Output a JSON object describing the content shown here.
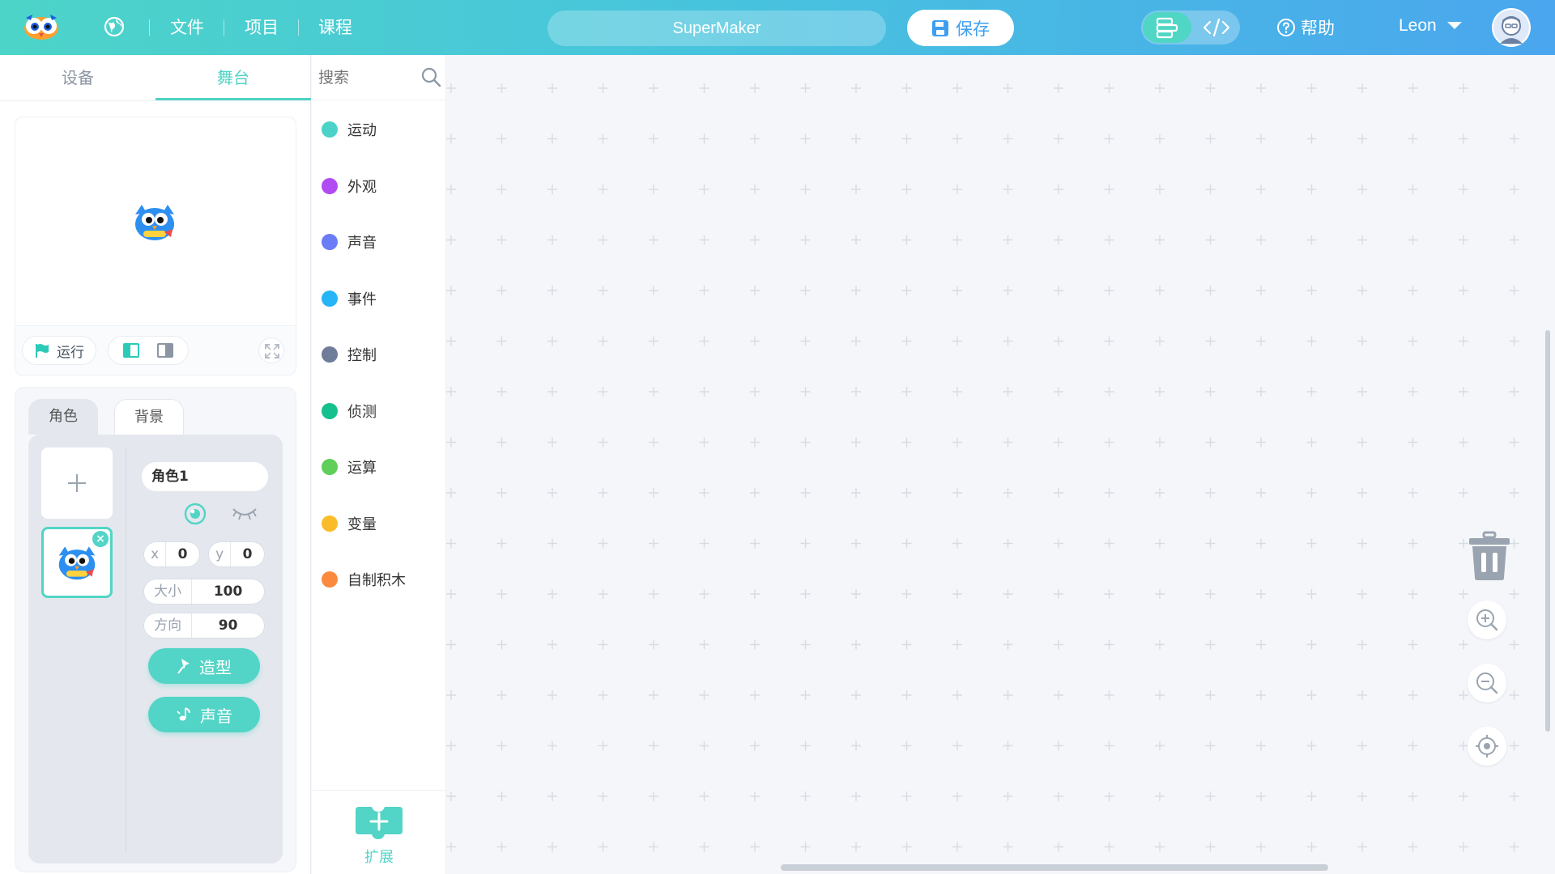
{
  "header": {
    "menu": [
      "文件",
      "项目",
      "课程"
    ],
    "project_name": "SuperMaker",
    "save_label": "保存",
    "help_label": "帮助",
    "user_name": "Leon"
  },
  "left_tabs": [
    "设备",
    "舞台"
  ],
  "stage": {
    "run_label": "运行"
  },
  "sprite_tabs": [
    "角色",
    "背景"
  ],
  "sprite": {
    "name": "角色1",
    "x_label": "x",
    "x": "0",
    "y_label": "y",
    "y": "0",
    "size_label": "大小",
    "size": "100",
    "direction_label": "方向",
    "direction": "90",
    "costume_label": "造型",
    "sound_label": "声音"
  },
  "search": {
    "placeholder": "搜索"
  },
  "categories": [
    {
      "label": "运动",
      "color": "#4cd2c8"
    },
    {
      "label": "外观",
      "color": "#b14cf2"
    },
    {
      "label": "声音",
      "color": "#6a7cf6"
    },
    {
      "label": "事件",
      "color": "#25b4f5"
    },
    {
      "label": "控制",
      "color": "#6f7c9a"
    },
    {
      "label": "侦测",
      "color": "#14c08d"
    },
    {
      "label": "运算",
      "color": "#5fcf5a"
    },
    {
      "label": "变量",
      "color": "#fbbc2a"
    },
    {
      "label": "自制积木",
      "color": "#fb8a3e"
    }
  ],
  "extension_label": "扩展"
}
